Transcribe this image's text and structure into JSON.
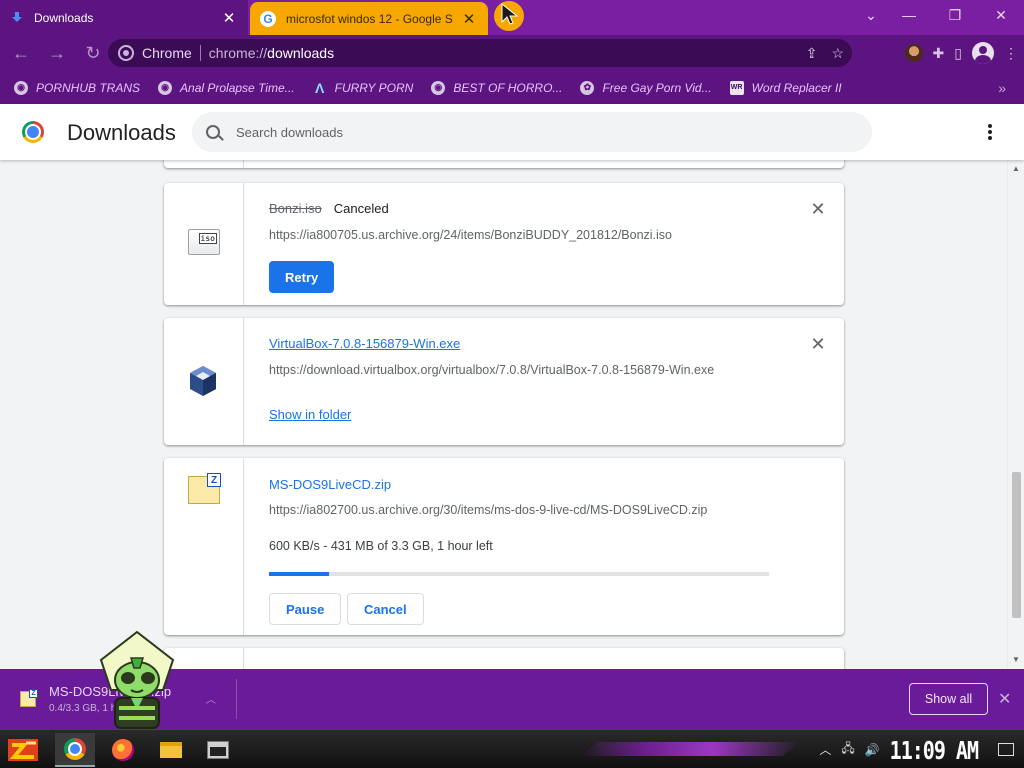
{
  "window": {
    "tabs": [
      {
        "title": "Downloads",
        "active": true
      },
      {
        "title": "microsfot windos 12 - Google S",
        "active": false
      }
    ],
    "controls": {
      "dropdown": "⌄",
      "minimize": "—",
      "restore": "❐",
      "close": "✕"
    }
  },
  "toolbar": {
    "chip_label": "Chrome",
    "url_scheme": "chrome://",
    "url_path": "downloads"
  },
  "bookmarks": [
    {
      "label": "PORNHUB TRANS",
      "icon": "globe-icon"
    },
    {
      "label": "Anal Prolapse Time...",
      "icon": "globe-icon"
    },
    {
      "label": "FURRY PORN",
      "icon": "a-logo-icon"
    },
    {
      "label": "BEST OF HORRO...",
      "icon": "globe-icon"
    },
    {
      "label": "Free Gay Porn Vid...",
      "icon": "ribbon-icon"
    },
    {
      "label": "Word Replacer II",
      "icon": "wr-icon"
    }
  ],
  "header": {
    "title": "Downloads",
    "search_placeholder": "Search downloads"
  },
  "downloads": [
    {
      "filename": "Bonzi.iso",
      "status": "Canceled",
      "url": "https://ia800705.us.archive.org/24/items/BonziBUDDY_201812/Bonzi.iso",
      "action": "Retry",
      "icon_tag": "iso"
    },
    {
      "filename": "VirtualBox-7.0.8-156879-Win.exe",
      "url": "https://download.virtualbox.org/virtualbox/7.0.8/VirtualBox-7.0.8-156879-Win.exe",
      "link": "Show in folder"
    },
    {
      "filename": "MS-DOS9LiveCD.zip",
      "url": "https://ia802700.us.archive.org/30/items/ms-dos-9-live-cd/MS-DOS9LiveCD.zip",
      "progress_text": "600 KB/s - 431 MB of 3.3 GB, 1 hour left",
      "progress_fraction": 0.12,
      "pause_label": "Pause",
      "cancel_label": "Cancel",
      "icon_tag": "Z"
    }
  ],
  "shelf": {
    "item_name": "MS-DOS9LiveCD.zip",
    "item_progress": "0.4/3.3 GB, 1 h",
    "show_all_label": "Show all"
  },
  "taskbar": {
    "clock": "11:09 AM"
  },
  "colors": {
    "accent": "#1a73e8",
    "frame": "#5c1480",
    "tab_inactive": "#f6a700",
    "bookmark_text": "#e9c1ff"
  }
}
